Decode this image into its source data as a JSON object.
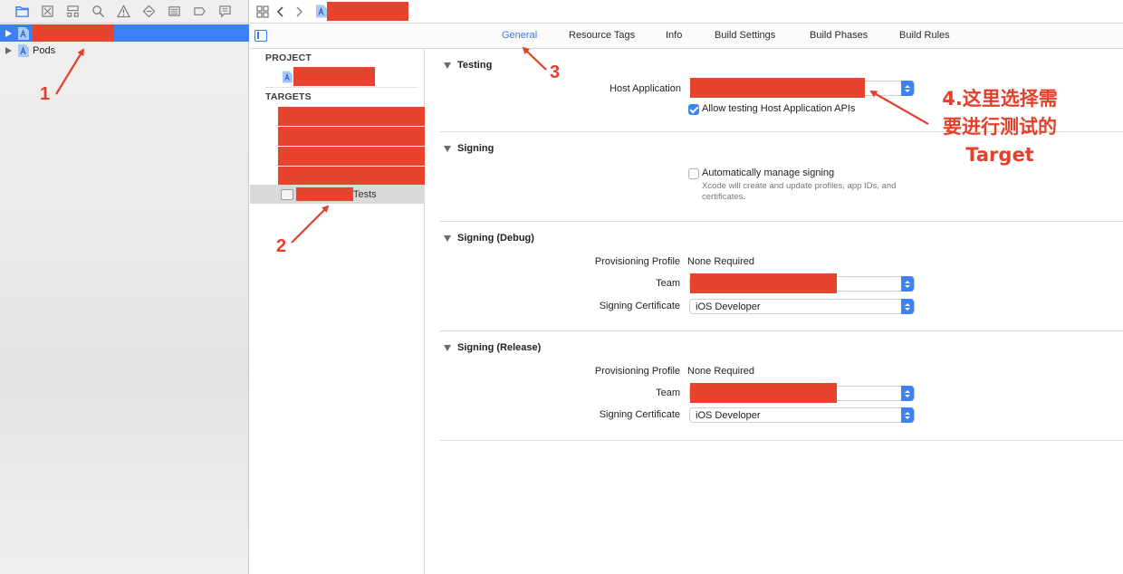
{
  "navigator": {
    "toolbar_icons": [
      "folder-icon",
      "source-control-icon",
      "symbol-icon",
      "search-icon",
      "warning-icon",
      "test-icon",
      "debug-icon",
      "breakpoint-icon",
      "report-icon"
    ],
    "items": [
      {
        "label": "",
        "redacted": true,
        "selected": true
      },
      {
        "label": "Pods",
        "redacted": false,
        "selected": false
      }
    ]
  },
  "tabs": [
    "General",
    "Resource Tags",
    "Info",
    "Build Settings",
    "Build Phases",
    "Build Rules"
  ],
  "active_tab": "General",
  "targets_panel": {
    "project_header": "PROJECT",
    "targets_header": "TARGETS",
    "selected_target_suffix": "Tests"
  },
  "testing": {
    "title": "Testing",
    "host_application_label": "Host Application",
    "allow_testing_label": "Allow testing Host Application APIs",
    "allow_testing_checked": true
  },
  "signing": {
    "title": "Signing",
    "auto_manage_label": "Automatically manage signing",
    "auto_manage_checked": false,
    "auto_manage_hint": "Xcode will create and update profiles, app IDs, and certificates."
  },
  "signing_debug": {
    "title": "Signing (Debug)",
    "profile_label": "Provisioning Profile",
    "profile_value": "None Required",
    "team_label": "Team",
    "cert_label": "Signing Certificate",
    "cert_value": "iOS Developer"
  },
  "signing_release": {
    "title": "Signing (Release)",
    "profile_label": "Provisioning Profile",
    "profile_value": "None Required",
    "team_label": "Team",
    "cert_label": "Signing Certificate",
    "cert_value": "iOS Developer"
  },
  "annotations": {
    "n1": "1",
    "n2": "2",
    "n3": "3",
    "note_line1": "4.这里选择需",
    "note_line2": "要进行测试的",
    "note_line3": "Target",
    "color": "#e4402b"
  },
  "colors": {
    "accent": "#3b82f5",
    "selection": "#3f7ff5",
    "redaction": "#e8432c"
  }
}
